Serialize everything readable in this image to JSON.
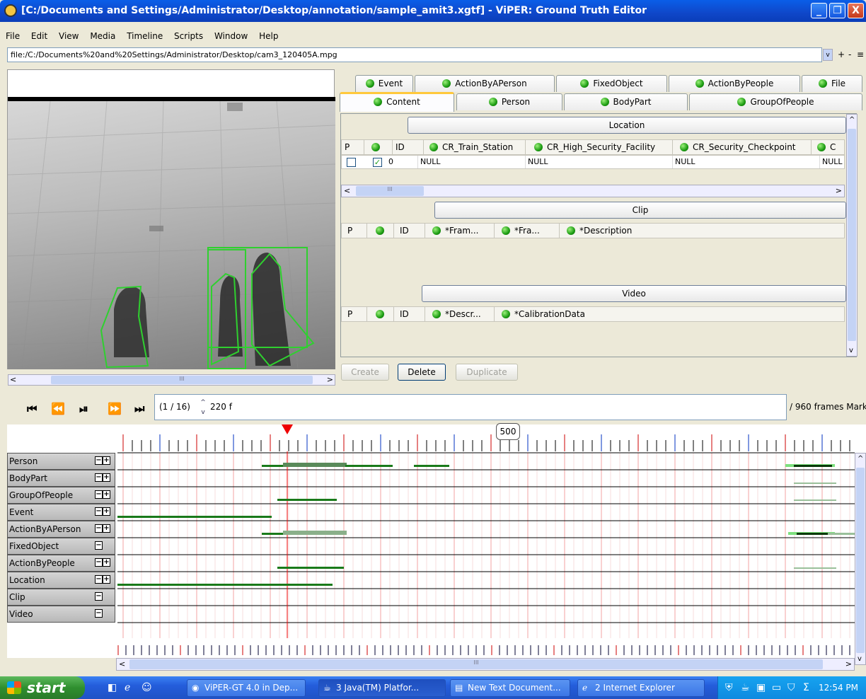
{
  "window": {
    "title": "[C:/Documents and Settings/Administrator/Desktop/annotation/sample_amit3.xgtf] - ViPER: Ground Truth Editor",
    "minimize": "_",
    "restore": "❐",
    "close": "X"
  },
  "menu": [
    "File",
    "Edit",
    "View",
    "Media",
    "Timeline",
    "Scripts",
    "Window",
    "Help"
  ],
  "url": {
    "value": "file:/C:/Documents%20and%20Settings/Administrator/Desktop/cam3_120405A.mpg",
    "dropdown": "v",
    "plus": "+",
    "minus": "-",
    "menu": "≡"
  },
  "tabs": {
    "row1": [
      "Event",
      "ActionByAPerson",
      "FixedObject",
      "ActionByPeople",
      "File"
    ],
    "row2": [
      "Content",
      "Person",
      "BodyPart",
      "GroupOfPeople"
    ],
    "selected": "Content"
  },
  "location": {
    "title": "Location",
    "headers": [
      "P",
      "",
      "ID",
      "CR_Train_Station",
      "CR_High_Security_Facility",
      "CR_Security_Checkpoint",
      "C"
    ],
    "row": {
      "id": "0",
      "cells": [
        "NULL",
        "NULL",
        "NULL",
        "NULL"
      ]
    }
  },
  "clip": {
    "title": "Clip",
    "headers": [
      "P",
      "",
      "ID",
      "*Fram...",
      "*Fra...",
      "*Description"
    ]
  },
  "video": {
    "title": "Video",
    "headers": [
      "P",
      "",
      "ID",
      "*Descr...",
      "*CalibrationData"
    ]
  },
  "buttons": {
    "create": "Create",
    "delete": "Delete",
    "duplicate": "Duplicate"
  },
  "frame": {
    "rate": "(1 / 16)",
    "current": "220 f",
    "total": "/ 960 frames Mark",
    "marker": "500",
    "spin_up": "^",
    "spin_down": "v"
  },
  "tracks": [
    "Person",
    "BodyPart",
    "GroupOfPeople",
    "Event",
    "ActionByAPerson",
    "FixedObject",
    "ActionByPeople",
    "Location",
    "Clip",
    "Video"
  ],
  "track_controls": [
    "−+",
    "−+",
    "−+",
    "−+",
    "−+",
    "−",
    "−+",
    "−+",
    "−",
    "−"
  ],
  "scroll": {
    "left": "<",
    "right": ">",
    "up": "^",
    "down": "v",
    "grip": "III"
  },
  "taskbar": {
    "start": "start",
    "items": [
      "ViPER-GT 4.0 in Dep...",
      "3 Java(TM) Platfor...",
      "New Text Document...",
      "2 Internet Explorer"
    ],
    "clock": "12:54 PM"
  }
}
